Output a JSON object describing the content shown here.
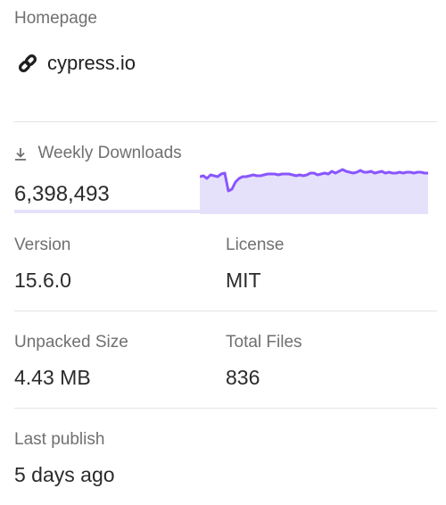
{
  "homepage": {
    "label": "Homepage",
    "link_text": "cypress.io",
    "icon": "link-icon"
  },
  "downloads": {
    "label": "Weekly Downloads",
    "icon": "download-icon",
    "count": "6,398,493",
    "colors": {
      "line": "#8956ff",
      "fill": "#e6e1fb"
    }
  },
  "stats": {
    "version": {
      "label": "Version",
      "value": "15.6.0"
    },
    "license": {
      "label": "License",
      "value": "MIT"
    },
    "unpacked_size": {
      "label": "Unpacked Size",
      "value": "4.43 MB"
    },
    "total_files": {
      "label": "Total Files",
      "value": "836"
    },
    "last_publish": {
      "label": "Last publish",
      "value": "5 days ago"
    }
  }
}
